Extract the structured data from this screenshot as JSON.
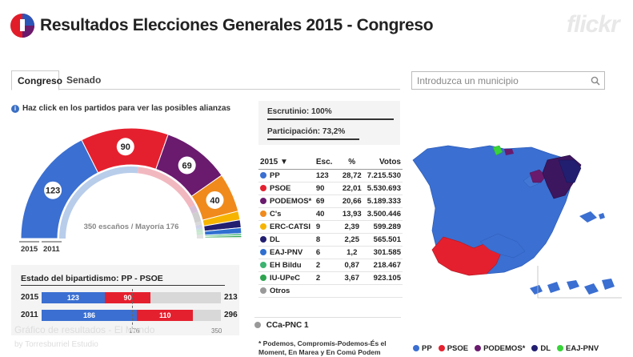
{
  "header": {
    "title": "Resultados Elecciones Generales 2015 - Congreso",
    "flickr": "flickr"
  },
  "tabs": [
    {
      "label": "Congreso"
    },
    {
      "label": "Senado"
    }
  ],
  "search": {
    "placeholder": "Introduzca un municipio"
  },
  "hint": "Haz click en los partidos para ver las posibles alianzas",
  "hemicycle": {
    "center_label": "350 escaños / Mayoría 176",
    "year_outer": "2015",
    "year_inner": "2011",
    "seat_labels": [
      "123",
      "90",
      "69",
      "40"
    ]
  },
  "scrutiny": {
    "escrutinio": "Escrutinio: 100%",
    "participacion": "Participación: 73,2%"
  },
  "results": {
    "headers": [
      "2015 ▼",
      "Esc.",
      "%",
      "Votos"
    ],
    "rows": [
      {
        "party": "PP",
        "seats": "123",
        "pct": "28,72",
        "votes": "7.215.530",
        "color": "#3b6fd1"
      },
      {
        "party": "PSOE",
        "seats": "90",
        "pct": "22,01",
        "votes": "5.530.693",
        "color": "#e5202e"
      },
      {
        "party": "PODEMOS*",
        "seats": "69",
        "pct": "20,66",
        "votes": "5.189.333",
        "color": "#6a1b6e"
      },
      {
        "party": "C's",
        "seats": "40",
        "pct": "13,93",
        "votes": "3.500.446",
        "color": "#f08a1c"
      },
      {
        "party": "ERC-CATSI",
        "seats": "9",
        "pct": "2,39",
        "votes": "599.289",
        "color": "#f6b400"
      },
      {
        "party": "DL",
        "seats": "8",
        "pct": "2,25",
        "votes": "565.501",
        "color": "#221e70"
      },
      {
        "party": "EAJ-PNV",
        "seats": "6",
        "pct": "1,2",
        "votes": "301.585",
        "color": "#2f6fd0"
      },
      {
        "party": "EH Bildu",
        "seats": "2",
        "pct": "0,87",
        "votes": "218.467",
        "color": "#3cb371"
      },
      {
        "party": "IU-UPeC",
        "seats": "2",
        "pct": "3,67",
        "votes": "923.105",
        "color": "#2ea44f"
      },
      {
        "party": "Otros",
        "seats": "",
        "pct": "",
        "votes": "",
        "color": "#999999"
      }
    ],
    "other": "CCa-PNC 1"
  },
  "note": "* Podemos, Compromís-Podemos-És el Moment, En Marea y En Comú Podem",
  "bipartidismo": {
    "title": "Estado del bipartidismo: PP - PSOE",
    "rows": [
      {
        "year": "2015",
        "pp": "123",
        "psoe": "90",
        "total": "213",
        "pp_seats": 123,
        "psoe_seats": 90
      },
      {
        "year": "2011",
        "pp": "186",
        "psoe": "110",
        "total": "296",
        "pp_seats": 186,
        "psoe_seats": 110
      }
    ],
    "axis_mid": "176",
    "axis_max": "350",
    "max": 350
  },
  "legend": [
    {
      "label": "PP",
      "color": "#3b6fd1"
    },
    {
      "label": "PSOE",
      "color": "#e5202e"
    },
    {
      "label": "PODEMOS*",
      "color": "#6a1b6e"
    },
    {
      "label": "DL",
      "color": "#221e70"
    },
    {
      "label": "EAJ-PNV",
      "color": "#39d33a"
    }
  ],
  "watermark": {
    "line1": "Gráfico de resultados - El Mundo",
    "line2": "by Torresburriel Estudio"
  }
}
